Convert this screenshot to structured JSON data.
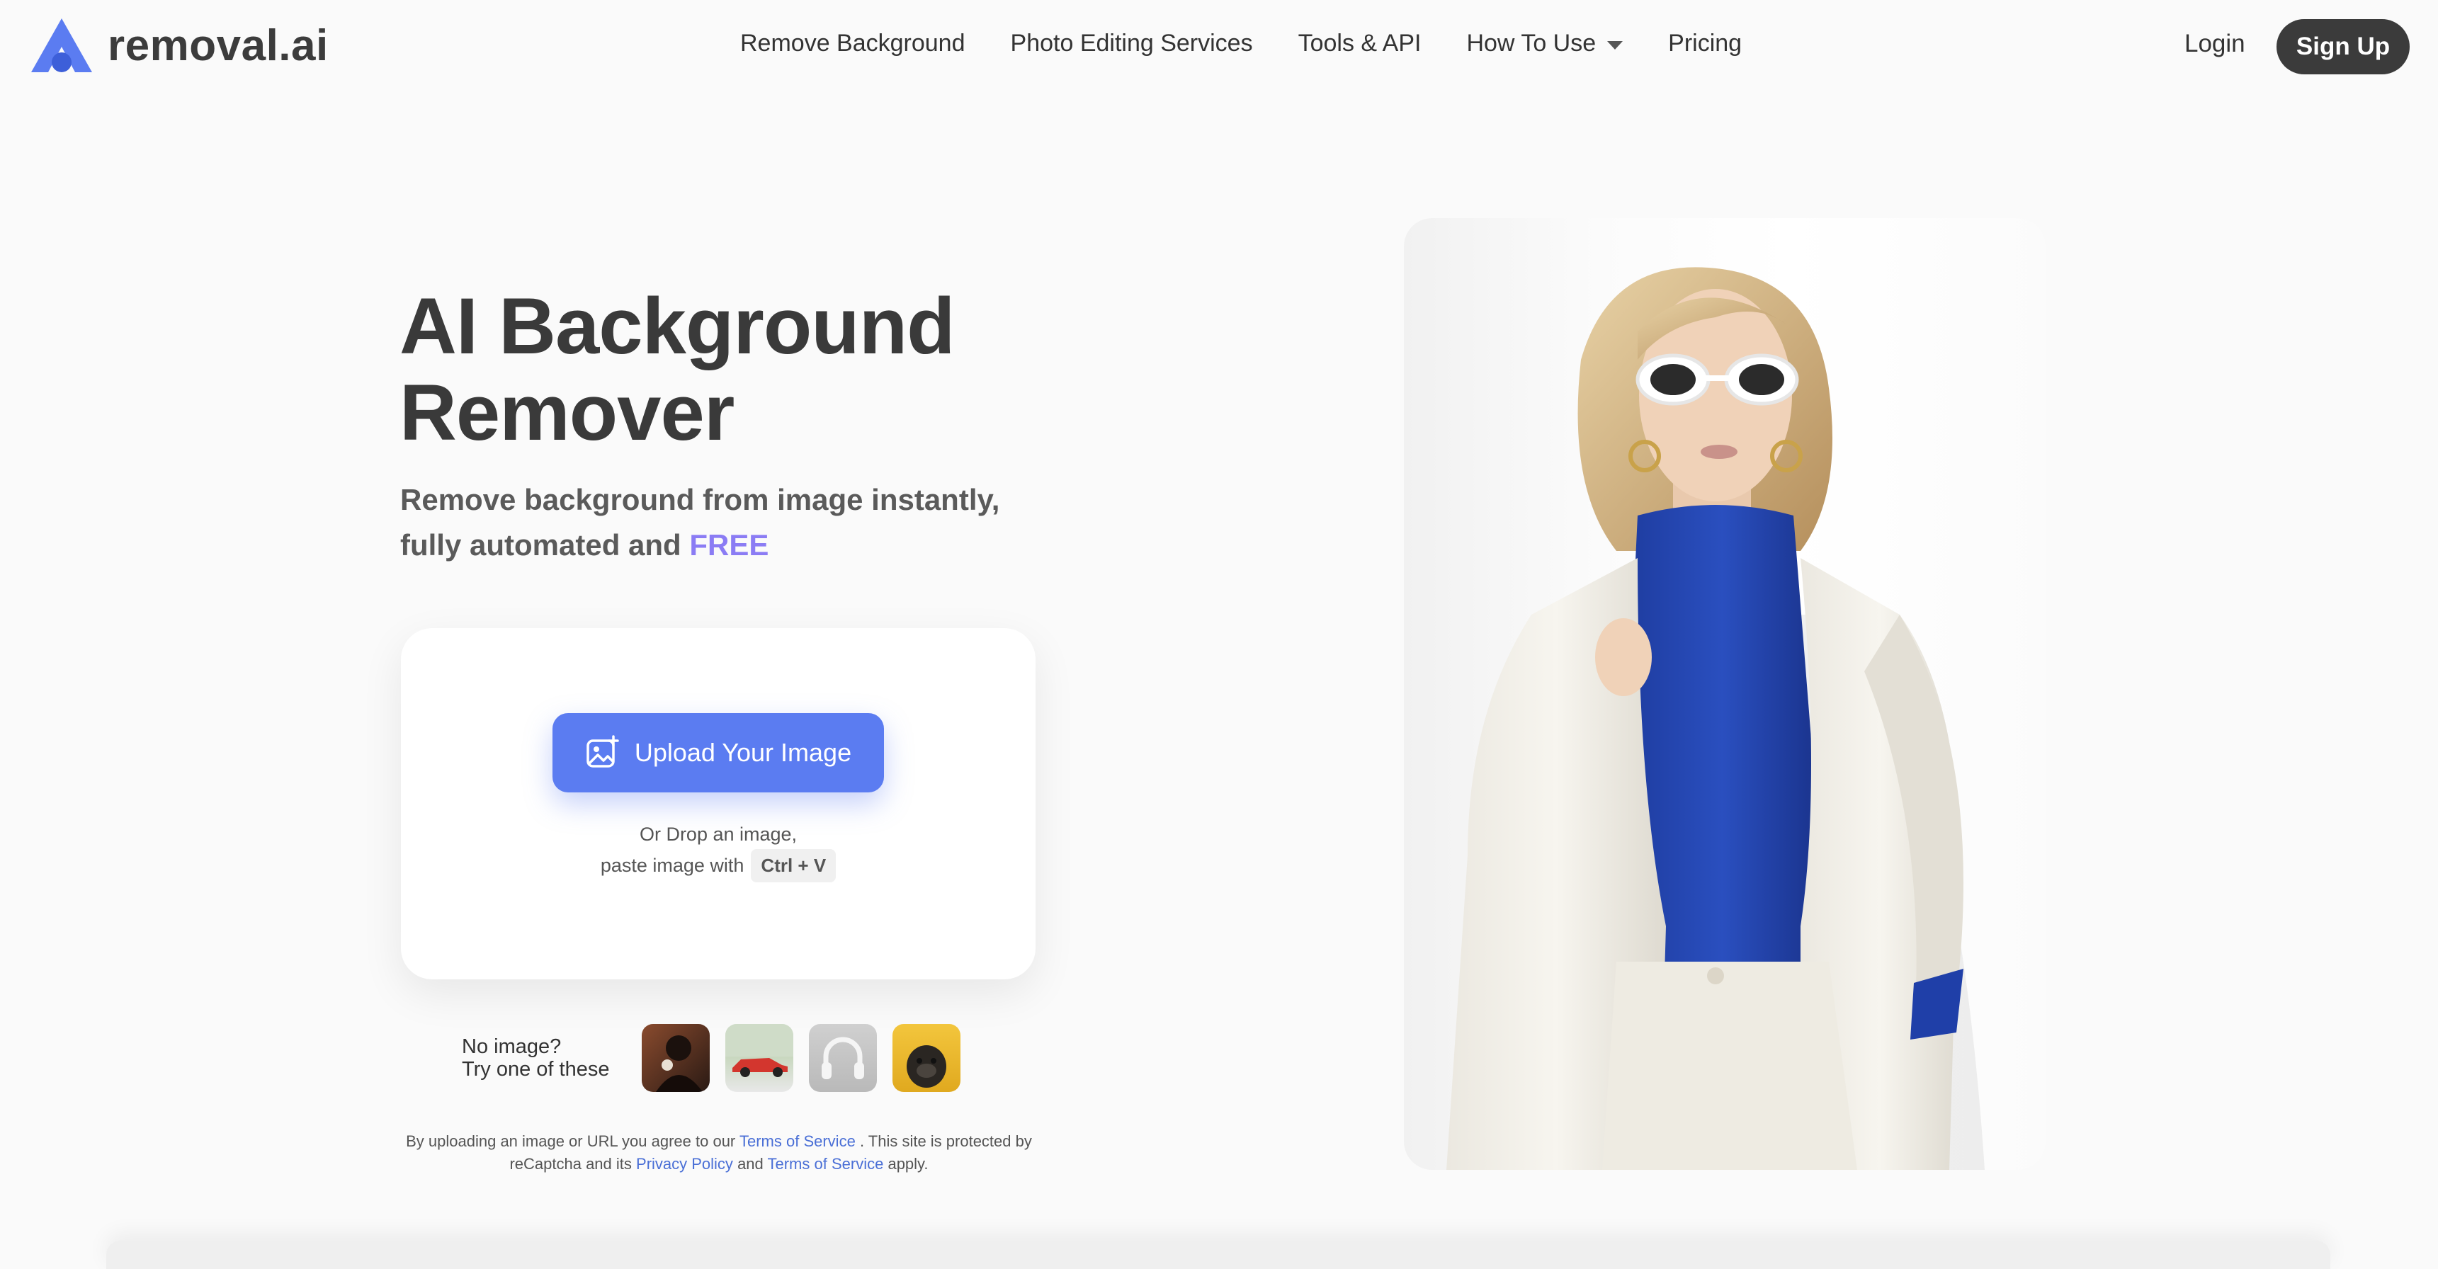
{
  "brand": {
    "name": "removal.ai",
    "accent": "#5b7cf1"
  },
  "nav": {
    "items": [
      {
        "label": "Remove Background"
      },
      {
        "label": "Photo Editing Services"
      },
      {
        "label": "Tools & API"
      },
      {
        "label": "How To Use",
        "has_dropdown": true
      },
      {
        "label": "Pricing"
      }
    ],
    "login": "Login",
    "signup": "Sign Up"
  },
  "hero": {
    "title_line1": "AI Background",
    "title_line2": "Remover",
    "subtitle_line1": "Remove background from image instantly,",
    "subtitle_line2_prefix": "fully automated and",
    "subtitle_free": "FREE",
    "free_color": "#8b7cf4"
  },
  "upload": {
    "button_label": "Upload Your Image",
    "drop_line1": "Or Drop an image,",
    "drop_line2_prefix": "paste image with",
    "shortcut": "Ctrl + V"
  },
  "samples": {
    "line1": "No image?",
    "line2": "Try one of these",
    "thumbnails": [
      {
        "icon": "portrait-thumbnail"
      },
      {
        "icon": "car-thumbnail"
      },
      {
        "icon": "headphones-thumbnail"
      },
      {
        "icon": "dog-thumbnail"
      }
    ]
  },
  "terms": {
    "part1": "By uploading an image or URL you agree to our",
    "link1": "Terms of Service",
    "part2": ". This site is protected by reCaptcha and its",
    "link2": "Privacy Policy",
    "part3": "and",
    "link3": "Terms of Service",
    "part4": "apply."
  }
}
